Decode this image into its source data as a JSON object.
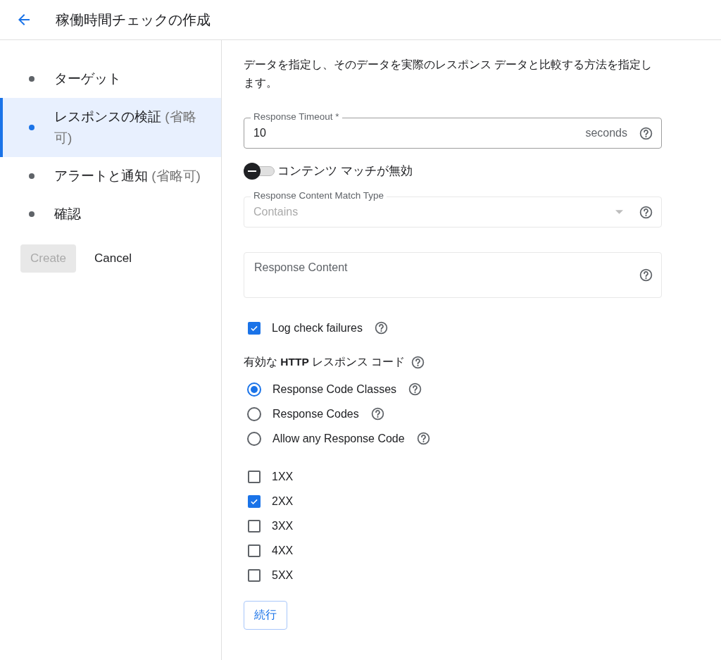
{
  "header": {
    "title": "稼働時間チェックの作成"
  },
  "steps": [
    {
      "label": "ターゲット",
      "selected": false
    },
    {
      "label": "レスポンスの検証",
      "note": "(省略可)",
      "selected": true
    },
    {
      "label": "アラートと通知",
      "note": "(省略可)",
      "selected": false
    },
    {
      "label": "確認",
      "selected": false
    }
  ],
  "actions": [
    {
      "label": "Create",
      "kind": "primary",
      "disabled": true
    },
    {
      "label": "Cancel",
      "kind": "text",
      "disabled": false
    }
  ],
  "description": "データを指定し、そのデータを実際のレスポンス データと比較する方法を指定します。",
  "timeout_field": {
    "label": "Response Timeout *",
    "value": "10",
    "suffix": "seconds"
  },
  "content_match_toggle": {
    "label": "コンテンツ マッチが無効",
    "on": false
  },
  "match_type_select": {
    "label": "Response Content Match Type",
    "value": "Contains",
    "disabled": true
  },
  "content_field": {
    "placeholder": "Response Content"
  },
  "log_failures": {
    "label": "Log check failures",
    "checked": true
  },
  "codes_heading": "有効な **HTTP** レスポンス コード",
  "code_options": [
    {
      "label": "Response Code Classes",
      "selected": true
    },
    {
      "label": "Response Codes",
      "selected": false
    },
    {
      "label": "Allow any Response Code",
      "selected": false
    }
  ],
  "code_classes": [
    {
      "label": "1XX",
      "checked": false
    },
    {
      "label": "2XX",
      "checked": true
    },
    {
      "label": "3XX",
      "checked": false
    },
    {
      "label": "4XX",
      "checked": false
    },
    {
      "label": "5XX",
      "checked": false
    }
  ],
  "continue_button": "続行"
}
